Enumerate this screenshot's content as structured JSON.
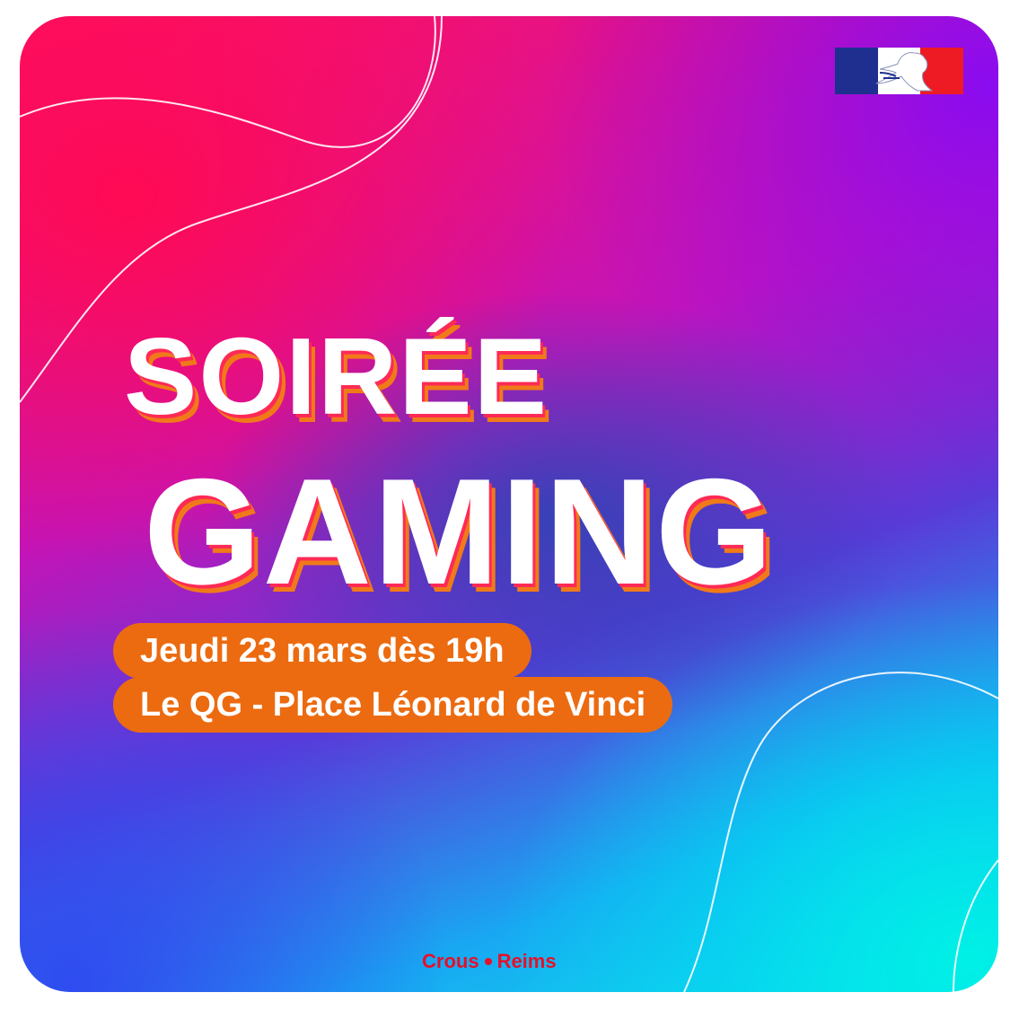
{
  "poster": {
    "title_line1": "SOIRÉE",
    "title_line2": "GAMING",
    "date_label": "Jeudi 23 mars dès 19h",
    "location_label": "Le QG - Place Léonard de Vinci",
    "organizer_part1": "Crous",
    "organizer_part2": "Reims"
  },
  "colors": {
    "pill": "#ec6b10",
    "title_shadow_red": "#ff2a55",
    "title_shadow_orange": "#f07a1a",
    "logo_red": "#e5102a",
    "flag_blue": "#1f2f8f",
    "flag_red": "#ee1b24"
  },
  "icons": {
    "government_logo": "french-republic-marianne-logo",
    "separator": "bullet-dot"
  }
}
